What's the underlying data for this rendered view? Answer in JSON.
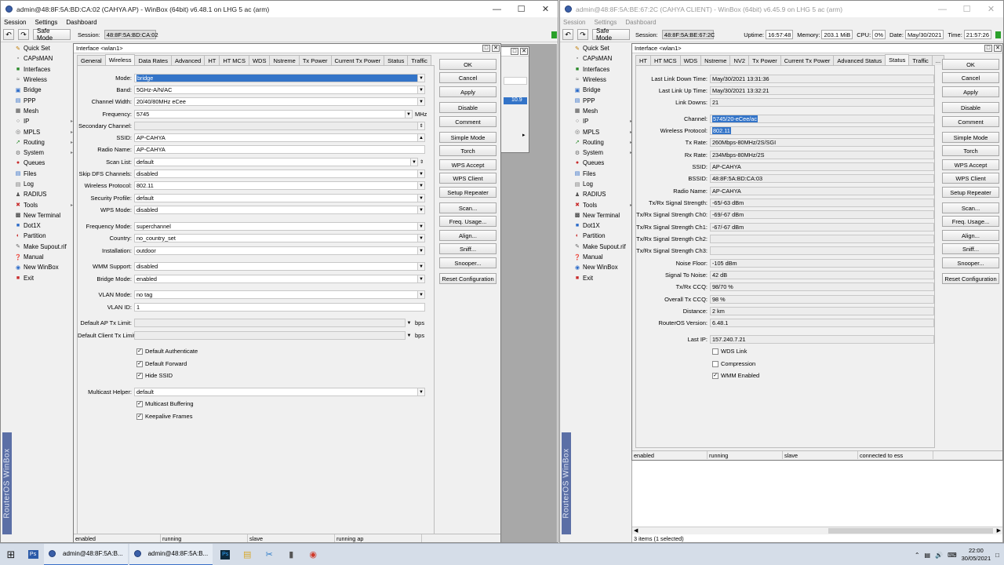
{
  "left": {
    "title": "admin@48:8F:5A:BD:CA:02 (CAHYA AP) - WinBox (64bit) v6.48.1 on LHG 5 ac (arm)",
    "menu": [
      "Session",
      "Settings",
      "Dashboard"
    ],
    "toolbar": {
      "safe_mode": "Safe Mode",
      "session_label": "Session:",
      "session_value": "48:8F:5A:BD:CA:02"
    },
    "sidebar": [
      "Quick Set",
      "CAPsMAN",
      "Interfaces",
      "Wireless",
      "Bridge",
      "PPP",
      "Mesh",
      "IP",
      "MPLS",
      "Routing",
      "System",
      "Queues",
      "Files",
      "Log",
      "RADIUS",
      "Tools",
      "New Terminal",
      "Dot1X",
      "Partition",
      "Make Supout.rif",
      "Manual",
      "New WinBox",
      "Exit"
    ],
    "brand": "RouterOS WinBox",
    "bg_dialog_value": "10.9",
    "dialog": {
      "title": "Interface <wlan1>",
      "tabs": [
        "General",
        "Wireless",
        "Data Rates",
        "Advanced",
        "HT",
        "HT MCS",
        "WDS",
        "Nstreme",
        "Tx Power",
        "Current Tx Power",
        "Status",
        "Traffic"
      ],
      "fields": {
        "mode": {
          "label": "Mode:",
          "value": "bridge"
        },
        "band": {
          "label": "Band:",
          "value": "5GHz-A/N/AC"
        },
        "channel_width": {
          "label": "Channel Width:",
          "value": "20/40/80MHz eCee"
        },
        "frequency": {
          "label": "Frequency:",
          "value": "5745",
          "unit": "MHz"
        },
        "secondary_channel": {
          "label": "Secondary Channel:",
          "value": ""
        },
        "ssid": {
          "label": "SSID:",
          "value": "AP-CAHYA"
        },
        "radio_name": {
          "label": "Radio Name:",
          "value": "AP-CAHYA"
        },
        "scan_list": {
          "label": "Scan List:",
          "value": "default"
        },
        "skip_dfs": {
          "label": "Skip DFS Channels:",
          "value": "disabled"
        },
        "wireless_protocol": {
          "label": "Wireless Protocol:",
          "value": "802.11"
        },
        "security_profile": {
          "label": "Security Profile:",
          "value": "default"
        },
        "wps_mode": {
          "label": "WPS Mode:",
          "value": "disabled"
        },
        "frequency_mode": {
          "label": "Frequency Mode:",
          "value": "superchannel"
        },
        "country": {
          "label": "Country:",
          "value": "no_country_set"
        },
        "installation": {
          "label": "Installation:",
          "value": "outdoor"
        },
        "wmm_support": {
          "label": "WMM Support:",
          "value": "disabled"
        },
        "bridge_mode": {
          "label": "Bridge Mode:",
          "value": "enabled"
        },
        "vlan_mode": {
          "label": "VLAN Mode:",
          "value": "no tag"
        },
        "vlan_id": {
          "label": "VLAN ID:",
          "value": "1"
        },
        "default_ap_tx": {
          "label": "Default AP Tx Limit:",
          "value": "",
          "unit": "bps"
        },
        "default_client_tx": {
          "label": "Default Client Tx Limit:",
          "value": "",
          "unit": "bps"
        },
        "multicast_helper": {
          "label": "Multicast Helper:",
          "value": "default"
        }
      },
      "checks": {
        "default_authenticate": "Default Authenticate",
        "default_forward": "Default Forward",
        "hide_ssid": "Hide SSID",
        "multicast_buffering": "Multicast Buffering",
        "keepalive_frames": "Keepalive Frames"
      },
      "buttons": [
        "OK",
        "Cancel",
        "Apply",
        "Disable",
        "Comment",
        "Simple Mode",
        "Torch",
        "WPS Accept",
        "WPS Client",
        "Setup Repeater",
        "Scan...",
        "Freq. Usage...",
        "Align...",
        "Sniff...",
        "Snooper...",
        "Reset Configuration"
      ],
      "status": [
        "enabled",
        "running",
        "slave",
        "running ap"
      ]
    }
  },
  "right": {
    "title": "admin@48:8F:5A:BE:67:2C (CAHYA CLIENT) - WinBox (64bit) v6.45.9 on LHG 5 ac (arm)",
    "menu": [
      "Session",
      "Settings",
      "Dashboard"
    ],
    "toolbar": {
      "safe_mode": "Safe Mode",
      "session_label": "Session:",
      "session_value": "48:8F:5A:BE:67:2C",
      "uptime_label": "Uptime:",
      "uptime": "16:57:48",
      "memory_label": "Memory:",
      "memory": "203.1 MiB",
      "cpu_label": "CPU:",
      "cpu": "0%",
      "date_label": "Date:",
      "date": "May/30/2021",
      "time_label": "Time:",
      "time": "21:57:26"
    },
    "sidebar": [
      "Quick Set",
      "CAPsMAN",
      "Interfaces",
      "Wireless",
      "Bridge",
      "PPP",
      "Mesh",
      "IP",
      "MPLS",
      "Routing",
      "System",
      "Queues",
      "Files",
      "Log",
      "RADIUS",
      "Tools",
      "New Terminal",
      "Dot1X",
      "Partition",
      "Make Supout.rif",
      "Manual",
      "New WinBox",
      "Exit"
    ],
    "brand": "RouterOS WinBox",
    "dialog": {
      "title": "Interface <wlan1>",
      "tabs": [
        "HT",
        "HT MCS",
        "WDS",
        "Nstreme",
        "NV2",
        "Tx Power",
        "Current Tx Power",
        "Advanced Status",
        "Status",
        "Traffic",
        "..."
      ],
      "rows": [
        {
          "label": "Last Link Down Time:",
          "value": "May/30/2021 13:31:36"
        },
        {
          "label": "Last Link Up Time:",
          "value": "May/30/2021 13:32:21"
        },
        {
          "label": "Link Downs:",
          "value": "21"
        },
        {
          "label": "Channel:",
          "value": "5745/20-eCee/ac"
        },
        {
          "label": "Wireless Protocol:",
          "value": "802.11"
        },
        {
          "label": "Tx Rate:",
          "value": "260Mbps-80MHz/2S/SGI"
        },
        {
          "label": "Rx Rate:",
          "value": "234Mbps-80MHz/2S"
        },
        {
          "label": "SSID:",
          "value": "AP-CAHYA"
        },
        {
          "label": "BSSID:",
          "value": "48:8F:5A:BD:CA:03"
        },
        {
          "label": "Radio Name:",
          "value": "AP-CAHYA"
        },
        {
          "label": "Tx/Rx Signal Strength:",
          "value": "-65/-63 dBm"
        },
        {
          "label": "Tx/Rx Signal Strength Ch0:",
          "value": "-69/-67 dBm"
        },
        {
          "label": "Tx/Rx Signal Strength Ch1:",
          "value": "-67/-67 dBm"
        },
        {
          "label": "Tx/Rx Signal Strength Ch2:",
          "value": ""
        },
        {
          "label": "Tx/Rx Signal Strength Ch3:",
          "value": ""
        },
        {
          "label": "Noise Floor:",
          "value": "-105 dBm"
        },
        {
          "label": "Signal To Noise:",
          "value": "42 dB"
        },
        {
          "label": "Tx/Rx CCQ:",
          "value": "98/70 %"
        },
        {
          "label": "Overall Tx CCQ:",
          "value": "98 %"
        },
        {
          "label": "Distance:",
          "value": "2 km"
        },
        {
          "label": "RouterOS Version:",
          "value": "6.48.1"
        },
        {
          "label": "Last IP:",
          "value": "157.240.7.21"
        }
      ],
      "checks": {
        "wds_link": "WDS Link",
        "compression": "Compression",
        "wmm_enabled": "WMM Enabled"
      },
      "buttons": [
        "OK",
        "Cancel",
        "Apply",
        "Disable",
        "Comment",
        "Simple Mode",
        "Torch",
        "WPS Accept",
        "WPS Client",
        "Setup Repeater",
        "Scan...",
        "Freq. Usage...",
        "Align...",
        "Sniff...",
        "Snooper...",
        "Reset Configuration"
      ],
      "status": [
        "enabled",
        "running",
        "slave",
        "connected to ess"
      ]
    },
    "list_status": "3 items (1 selected)"
  },
  "taskbar": {
    "app1": "admin@48:8F:5A:B...",
    "app2": "admin@48:8F:5A:B...",
    "time": "22:00",
    "date": "30/05/2021"
  }
}
